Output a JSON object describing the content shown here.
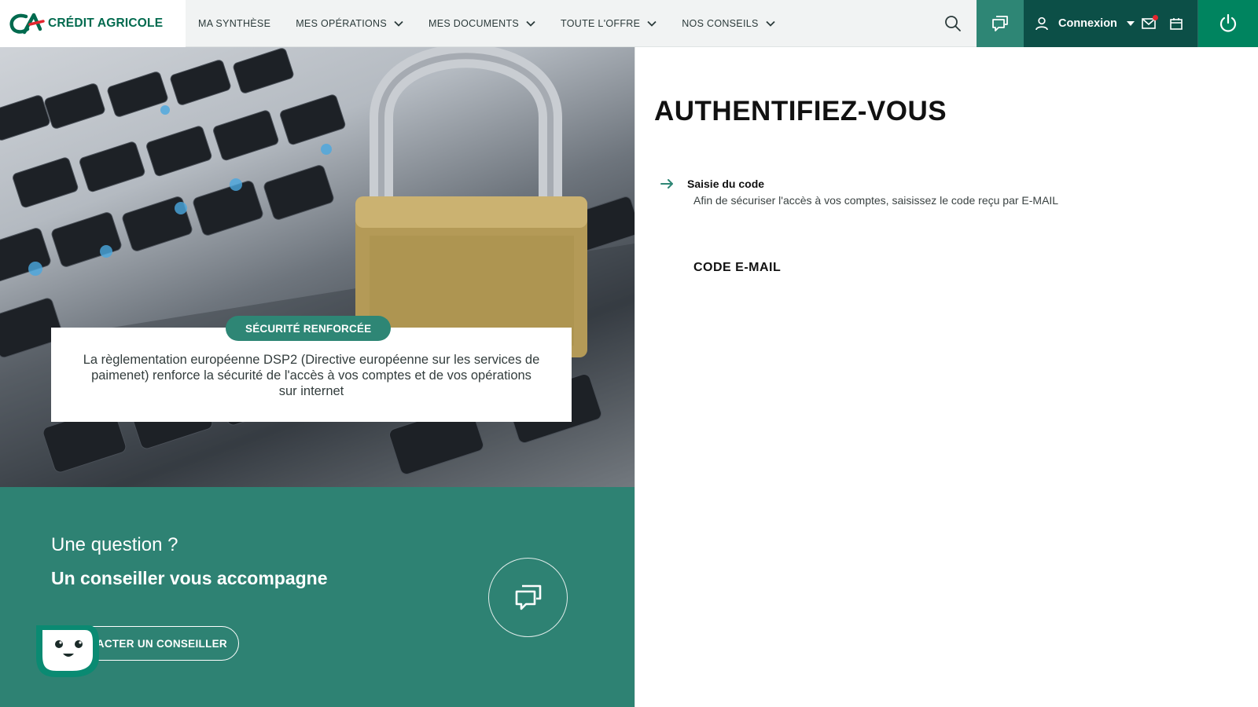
{
  "brand": {
    "name": "CRÉDIT AGRICOLE"
  },
  "nav": {
    "items": [
      {
        "label": "MA SYNTHÈSE",
        "has_dropdown": false
      },
      {
        "label": "MES OPÉRATIONS",
        "has_dropdown": true
      },
      {
        "label": "MES DOCUMENTS",
        "has_dropdown": true
      },
      {
        "label": "TOUTE L'OFFRE",
        "has_dropdown": true
      },
      {
        "label": "NOS CONSEILS",
        "has_dropdown": true
      }
    ]
  },
  "account": {
    "login_label": "Connexion"
  },
  "hero": {
    "badge": "SÉCURITÉ RENFORCÉE",
    "text": "La règlementation européenne DSP2 (Directive européenne sur les services de paimenet) renforce la sécurité de l'accès à vos comptes et de vos opérations sur internet"
  },
  "advisor": {
    "question": "Une question ?",
    "subtitle": "Un conseiller vous accompagne",
    "contact_label": "ACTER UN CONSEILLER"
  },
  "auth": {
    "title": "AUTHENTIFIEZ-VOUS",
    "step_title": "Saisie du code",
    "step_desc": "Afin de sécuriser l'accès à vos comptes, saisissez le code reçu par E-MAIL",
    "code_label": "CODE E-MAIL"
  },
  "colors": {
    "brand_green": "#006a4e",
    "accent_teal": "#2e8675",
    "dark_teal": "#0c4f47",
    "power_green": "#00845f",
    "notification_red": "#e3262f"
  },
  "icons": [
    "logo-mark-icon",
    "chevron-down-icon",
    "search-icon",
    "chat-icon",
    "user-icon",
    "caret-down-icon",
    "mail-icon",
    "calendar-icon",
    "power-icon",
    "arrow-right-icon",
    "padlock-image",
    "chatbot-icon"
  ]
}
